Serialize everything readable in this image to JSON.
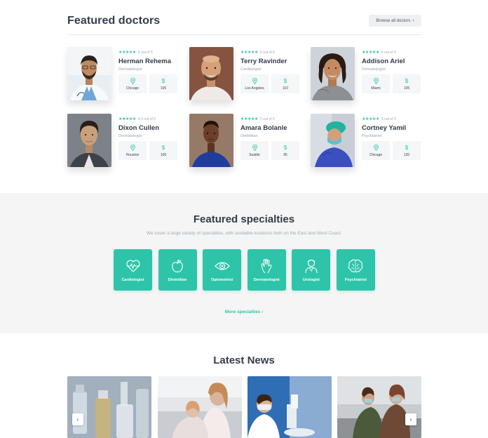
{
  "doctors_section": {
    "title": "Featured doctors",
    "browse_label": "Browse all doctors",
    "doctors": [
      {
        "name": "Herman Rehema",
        "specialty": "Dermatologist",
        "stars": "★★★★★",
        "rating": "5 out of 5",
        "location": "Chicago",
        "price": "105"
      },
      {
        "name": "Terry Ravinder",
        "specialty": "Cardiologist",
        "stars": "★★★★★",
        "rating": "5 out of 5",
        "location": "Los Angeles",
        "price": "110"
      },
      {
        "name": "Addison Ariel",
        "specialty": "Dermatologist",
        "stars": "★★★★★",
        "rating": "5 out of 5",
        "location": "Miami",
        "price": "105"
      },
      {
        "name": "Dixon Cullen",
        "specialty": "Dermatologist",
        "stars": "★★★★★",
        "rating": "4.5 out of 5",
        "location": "Houston",
        "price": "100"
      },
      {
        "name": "Amara Bolanle",
        "specialty": "Dietetitian",
        "stars": "★★★★★",
        "rating": "5 out of 5",
        "location": "Seattle",
        "price": "95"
      },
      {
        "name": "Cortney Yamil",
        "specialty": "Psychiatrist",
        "stars": "★★★★★",
        "rating": "5 out of 5",
        "location": "Chicago",
        "price": "120"
      }
    ]
  },
  "specialties_section": {
    "title": "Featured specialties",
    "subtitle": "We cover a large variety of specialties, with available locations both on the East and West Coast.",
    "tiles": [
      {
        "label": "Cardiologist",
        "icon": "heart-pulse-icon"
      },
      {
        "label": "Dietetitian",
        "icon": "apple-icon"
      },
      {
        "label": "Optometrist",
        "icon": "eye-icon"
      },
      {
        "label": "Dermatologist",
        "icon": "hand-icon"
      },
      {
        "label": "Urologist",
        "icon": "doctor-icon"
      },
      {
        "label": "Psychiatrist",
        "icon": "brain-icon"
      }
    ],
    "more_label": "More specialties  ›"
  },
  "news_section": {
    "title": "Latest News",
    "prev_icon": "chevron-left-icon",
    "next_icon": "chevron-right-icon"
  },
  "colors": {
    "accent": "#2ec4a9",
    "heading": "#333d4a",
    "muted": "#9aa3ad",
    "section_bg": "#f4f5f4"
  }
}
